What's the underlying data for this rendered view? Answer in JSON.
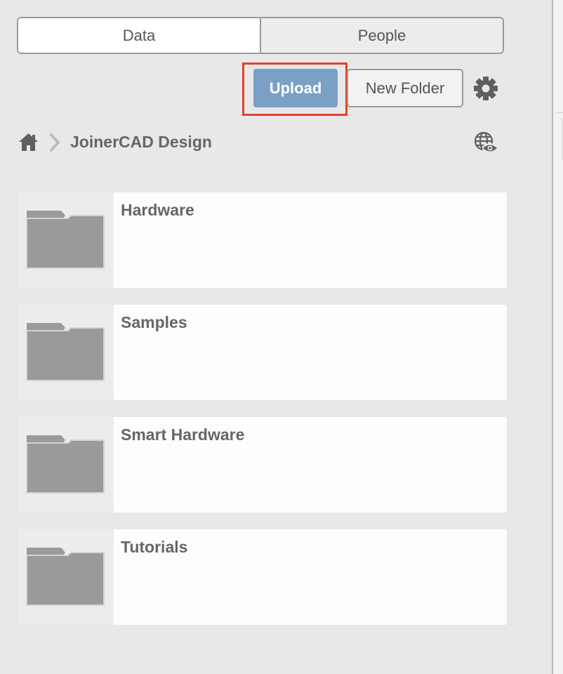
{
  "tabs": [
    {
      "label": "Data",
      "active": true
    },
    {
      "label": "People",
      "active": false
    }
  ],
  "toolbar": {
    "upload_label": "Upload",
    "new_folder_label": "New Folder",
    "settings_icon": "gear-icon"
  },
  "breadcrumb": {
    "home_icon": "home-icon",
    "current": "JoinerCAD Design",
    "visibility_icon": "globe-eye-icon"
  },
  "folders": [
    {
      "name": "Hardware"
    },
    {
      "name": "Samples"
    },
    {
      "name": "Smart Hardware"
    },
    {
      "name": "Tutorials"
    }
  ],
  "colors": {
    "background": "#e8e8e8",
    "upload_button": "#7aa0c5",
    "highlight_border": "#e0432b",
    "folder_icon": "#9a9a9a",
    "text": "#666666"
  }
}
